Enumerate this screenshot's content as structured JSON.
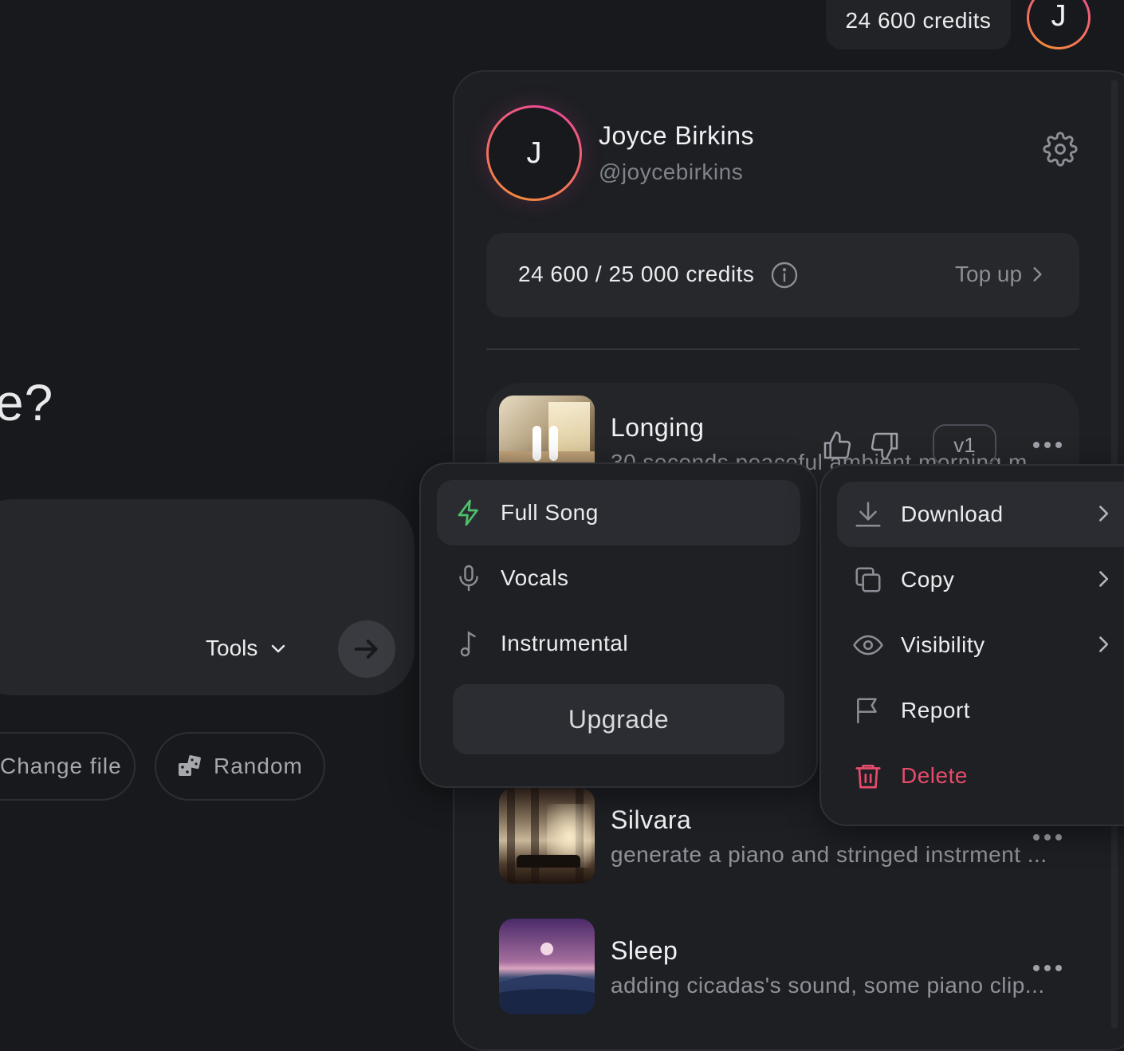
{
  "header": {
    "credits_label": "24 600 credits",
    "avatar_initial": "J"
  },
  "background": {
    "hero_fragment": "e?",
    "tools_label": "Tools",
    "change_file_label": "Change file",
    "random_label": "Random"
  },
  "profile": {
    "avatar_initial": "J",
    "name": "Joyce Birkins",
    "handle": "@joycebirkins",
    "credits_text": "24 600 / 25 000 credits",
    "top_up_label": "Top up"
  },
  "songs": [
    {
      "title": "Longing",
      "description": "30 seconds peaceful ambient morning m",
      "version": "v1",
      "playing": true
    },
    {
      "title": "Silvara",
      "description": "generate a piano and stringed instrment ..."
    },
    {
      "title": "Sleep",
      "description": "adding cicadas's sound, some piano clip..."
    }
  ],
  "download_menu": {
    "items": [
      {
        "label": "Full Song",
        "icon": "lightning-icon"
      },
      {
        "label": "Vocals",
        "icon": "microphone-icon"
      },
      {
        "label": "Instrumental",
        "icon": "music-note-icon"
      }
    ],
    "upgrade_label": "Upgrade"
  },
  "context_menu": {
    "items": [
      {
        "label": "Download",
        "icon": "download-icon"
      },
      {
        "label": "Copy",
        "icon": "copy-icon"
      },
      {
        "label": "Visibility",
        "icon": "eye-icon"
      },
      {
        "label": "Report",
        "icon": "flag-icon"
      },
      {
        "label": "Delete",
        "icon": "trash-icon"
      }
    ]
  },
  "colors": {
    "background": "#17191c",
    "panel": "#1d1f23",
    "accent_green": "#4fbf6a",
    "danger": "#e64b6a",
    "avatar_gradient": [
      "#f58a3a",
      "#ec4899"
    ]
  }
}
